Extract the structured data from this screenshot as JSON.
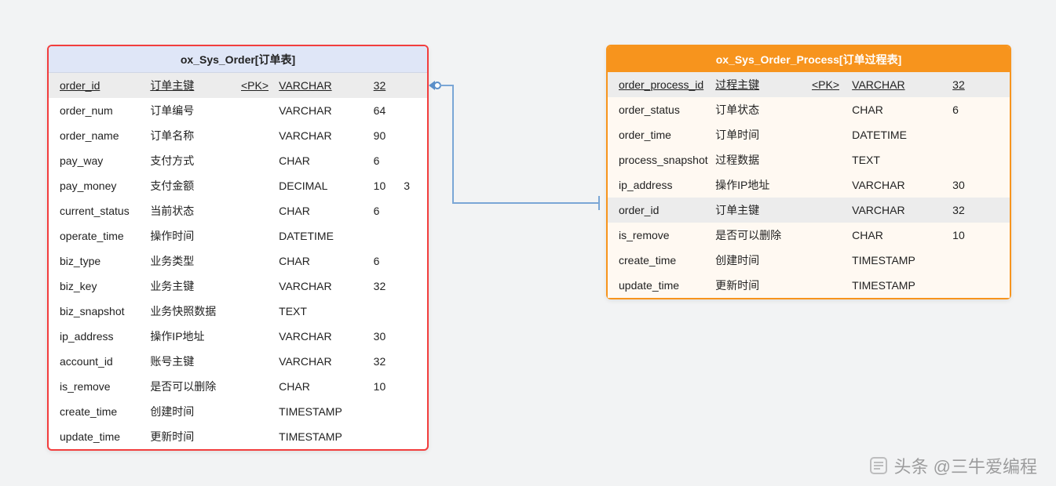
{
  "watermark": "头条 @三牛爱编程",
  "tables": [
    {
      "title": "ox_Sys_Order[订单表]",
      "side": "left",
      "columns": [
        {
          "name": "order_id",
          "cn": "订单主键",
          "pk": "<PK>",
          "type": "VARCHAR",
          "len": "32",
          "len2": "",
          "is_pk": true
        },
        {
          "name": "order_num",
          "cn": "订单编号",
          "pk": "",
          "type": "VARCHAR",
          "len": "64",
          "len2": ""
        },
        {
          "name": "order_name",
          "cn": "订单名称",
          "pk": "",
          "type": "VARCHAR",
          "len": "90",
          "len2": ""
        },
        {
          "name": "pay_way",
          "cn": "支付方式",
          "pk": "",
          "type": "CHAR",
          "len": "6",
          "len2": ""
        },
        {
          "name": "pay_money",
          "cn": "支付金额",
          "pk": "",
          "type": "DECIMAL",
          "len": "10",
          "len2": "3"
        },
        {
          "name": "current_status",
          "cn": "当前状态",
          "pk": "",
          "type": "CHAR",
          "len": "6",
          "len2": ""
        },
        {
          "name": "operate_time",
          "cn": "操作时间",
          "pk": "",
          "type": "DATETIME",
          "len": "",
          "len2": ""
        },
        {
          "name": "biz_type",
          "cn": "业务类型",
          "pk": "",
          "type": "CHAR",
          "len": "6",
          "len2": ""
        },
        {
          "name": "biz_key",
          "cn": "业务主键",
          "pk": "",
          "type": "VARCHAR",
          "len": "32",
          "len2": ""
        },
        {
          "name": "biz_snapshot",
          "cn": "业务快照数据",
          "pk": "",
          "type": "TEXT",
          "len": "",
          "len2": ""
        },
        {
          "name": "ip_address",
          "cn": "操作IP地址",
          "pk": "",
          "type": "VARCHAR",
          "len": "30",
          "len2": ""
        },
        {
          "name": "account_id",
          "cn": "账号主键",
          "pk": "",
          "type": "VARCHAR",
          "len": "32",
          "len2": ""
        },
        {
          "name": "is_remove",
          "cn": "是否可以删除",
          "pk": "",
          "type": "CHAR",
          "len": "10",
          "len2": ""
        },
        {
          "name": "create_time",
          "cn": "创建时间",
          "pk": "",
          "type": "TIMESTAMP",
          "len": "",
          "len2": ""
        },
        {
          "name": "update_time",
          "cn": "更新时间",
          "pk": "",
          "type": "TIMESTAMP",
          "len": "",
          "len2": ""
        }
      ]
    },
    {
      "title": "ox_Sys_Order_Process[订单过程表]",
      "side": "right",
      "columns": [
        {
          "name": "order_process_id",
          "cn": "过程主键",
          "pk": "<PK>",
          "type": "VARCHAR",
          "len": "32",
          "len2": "",
          "is_pk": true
        },
        {
          "name": "order_status",
          "cn": "订单状态",
          "pk": "",
          "type": "CHAR",
          "len": "6",
          "len2": ""
        },
        {
          "name": "order_time",
          "cn": "订单时间",
          "pk": "",
          "type": "DATETIME",
          "len": "",
          "len2": ""
        },
        {
          "name": "process_snapshot",
          "cn": "过程数据",
          "pk": "",
          "type": "TEXT",
          "len": "",
          "len2": ""
        },
        {
          "name": "ip_address",
          "cn": "操作IP地址",
          "pk": "",
          "type": "VARCHAR",
          "len": "30",
          "len2": ""
        },
        {
          "name": "order_id",
          "cn": "订单主键",
          "pk": "",
          "type": "VARCHAR",
          "len": "32",
          "len2": "",
          "is_fk": true
        },
        {
          "name": "is_remove",
          "cn": "是否可以删除",
          "pk": "",
          "type": "CHAR",
          "len": "10",
          "len2": ""
        },
        {
          "name": "create_time",
          "cn": "创建时间",
          "pk": "",
          "type": "TIMESTAMP",
          "len": "",
          "len2": ""
        },
        {
          "name": "update_time",
          "cn": "更新时间",
          "pk": "",
          "type": "TIMESTAMP",
          "len": "",
          "len2": ""
        }
      ]
    }
  ]
}
